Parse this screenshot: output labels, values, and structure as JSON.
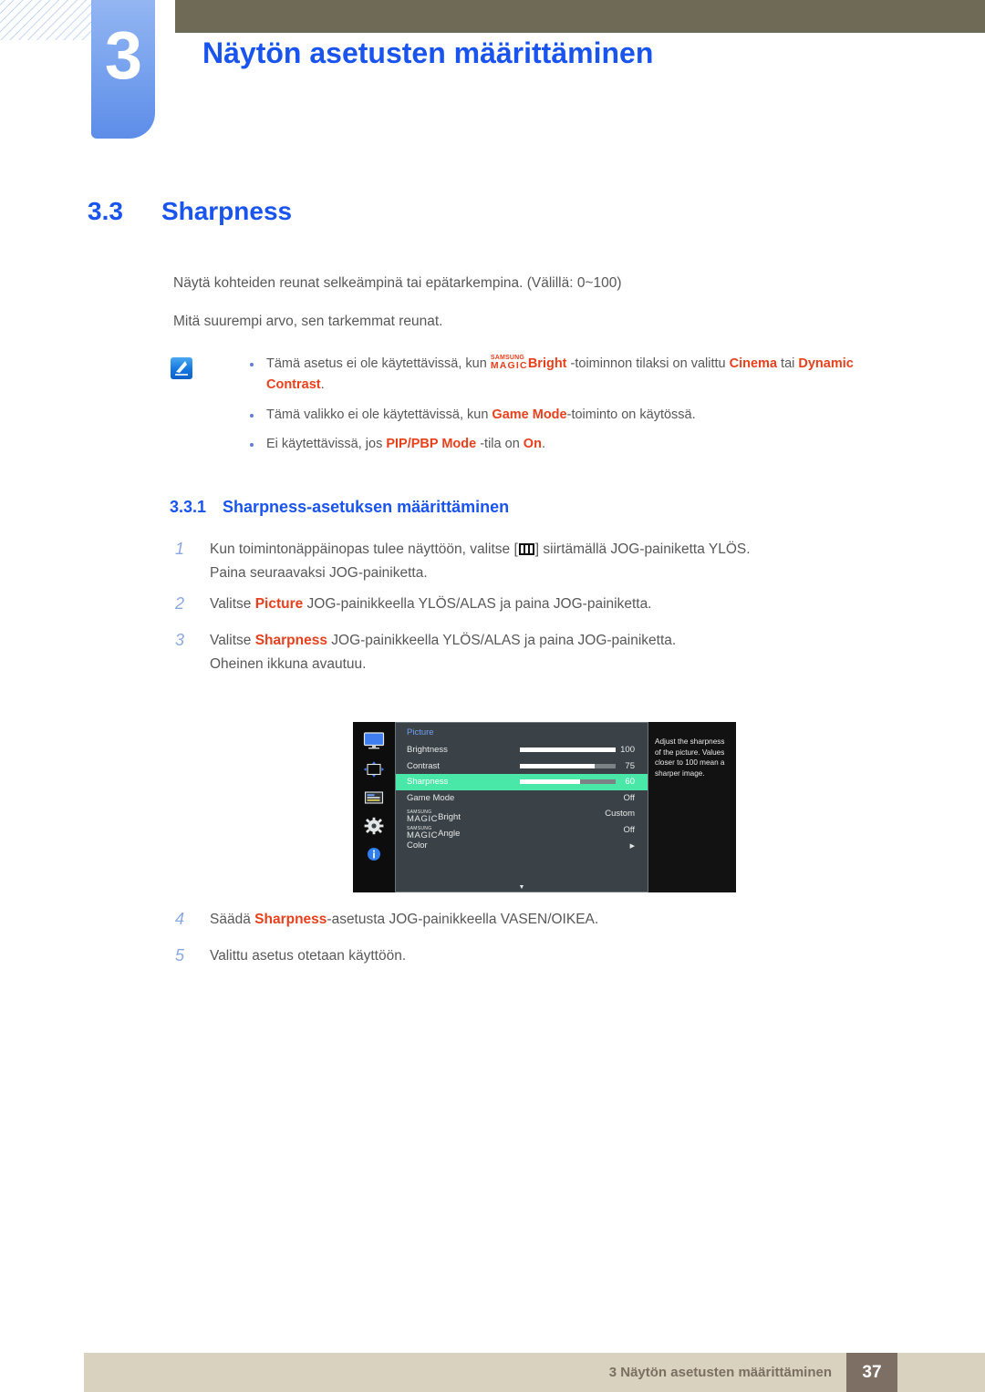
{
  "header": {
    "chapter_number": "3",
    "chapter_title": "Näytön asetusten määrittäminen",
    "accent_blue": "#1a54ef",
    "olive_bar_color": "#6e6a55"
  },
  "section": {
    "number": "3.3",
    "title": "Sharpness"
  },
  "intro": {
    "line1": "Näytä kohteiden reunat selkeämpinä tai epätarkempina. (Välillä: 0~100)",
    "line2": "Mitä suurempi arvo, sen tarkemmat reunat."
  },
  "note": {
    "icon_name": "note-pen-icon",
    "keyword_color": "#e8401c",
    "bullets": [
      {
        "part1": "Tämä asetus ei ole käytettävissä, kun ",
        "magic_top": "SAMSUNG",
        "magic_bottom": "MAGIC",
        "magic_suffix": "Bright",
        "part2": " -toiminnon tilaksi on valittu ",
        "kw1": "Cinema",
        "part3": " tai ",
        "kw2": "Dynamic Contrast",
        "part4": "."
      },
      {
        "part1": "Tämä valikko ei ole käytettävissä, kun ",
        "kw1": "Game Mode",
        "part2": "-toiminto on käytössä."
      },
      {
        "part1": "Ei käytettävissä, jos ",
        "kw1": "PIP/PBP Mode",
        "part2": " -tila on ",
        "kw2": "On",
        "part3": "."
      }
    ]
  },
  "subsection": {
    "number": "3.3.1",
    "title": "Sharpness-asetuksen määrittäminen"
  },
  "steps": {
    "step1": {
      "num": "1",
      "pre": "Kun toimintonäppäinopas tulee näyttöön, valitse [",
      "icon_name": "jog-menu-icon",
      "post": "] siirtämällä JOG-painiketta YLÖS.",
      "sub": "Paina seuraavaksi JOG-painiketta."
    },
    "step2": {
      "num": "2",
      "pre": "Valitse ",
      "kw": "Picture",
      "post": " JOG-painikkeella YLÖS/ALAS ja paina JOG-painiketta."
    },
    "step3": {
      "num": "3",
      "pre": "Valitse ",
      "kw": "Sharpness",
      "post": " JOG-painikkeella YLÖS/ALAS ja paina JOG-painiketta.",
      "sub": "Oheinen ikkuna avautuu."
    },
    "step4": {
      "num": "4",
      "pre": "Säädä ",
      "kw": "Sharpness",
      "post": "-asetusta JOG-painikkeella VASEN/OIKEA."
    },
    "step5": {
      "num": "5",
      "pre": "Valittu asetus otetaan käyttöön."
    }
  },
  "osd": {
    "title": "Picture",
    "highlight_color": "#4ae8a8",
    "sidebar_icons": [
      "monitor-icon",
      "screen-adjust-icon",
      "osd-list-icon",
      "gear-icon",
      "info-icon"
    ],
    "rows": [
      {
        "label": "Brightness",
        "type": "slider",
        "value": "100",
        "fill_pct": 100,
        "selected": false
      },
      {
        "label": "Contrast",
        "type": "slider",
        "value": "75",
        "fill_pct": 78,
        "selected": false
      },
      {
        "label": "Sharpness",
        "type": "slider",
        "value": "60",
        "fill_pct": 63,
        "selected": true
      },
      {
        "label": "Game Mode",
        "type": "value",
        "value": "Off",
        "selected": false
      },
      {
        "label": "MAGICBright",
        "type": "magic",
        "magic_top": "SAMSUNG",
        "magic_bottom": "MAGIC",
        "magic_suffix": "Bright",
        "value": "Custom",
        "selected": false
      },
      {
        "label": "MAGICAngle",
        "type": "magic",
        "magic_top": "SAMSUNG",
        "magic_bottom": "MAGIC",
        "magic_suffix": "Angle",
        "value": "Off",
        "selected": false
      },
      {
        "label": "Color",
        "type": "submenu",
        "value": "▶",
        "selected": false
      }
    ],
    "scroll_down_glyph": "▼",
    "help_text": "Adjust the sharpness of the picture. Values closer to 100 mean a sharper image."
  },
  "footer": {
    "text": "3 Näytön asetusten määrittäminen",
    "page": "37",
    "bar_color": "#d8d2be",
    "page_box_color": "#7d6f63"
  }
}
